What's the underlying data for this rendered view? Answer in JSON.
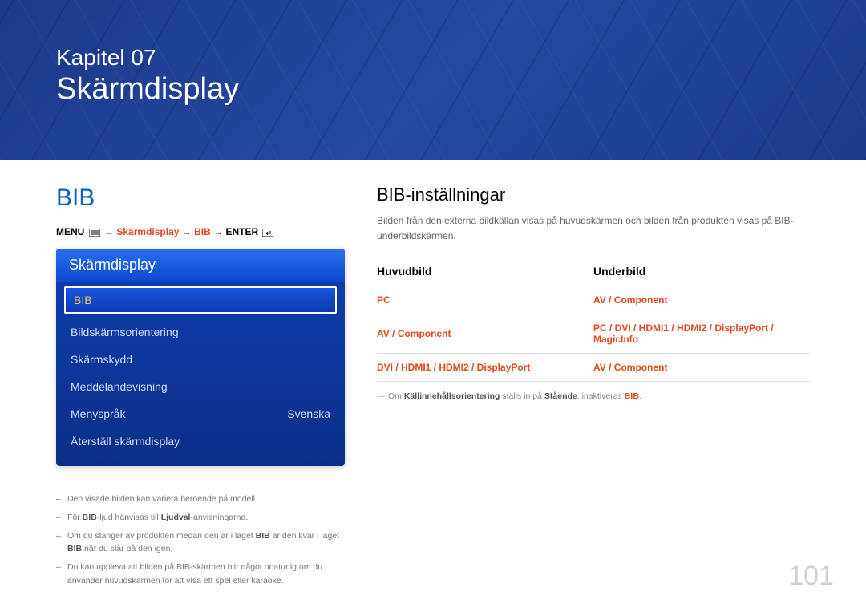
{
  "banner": {
    "kicker": "Kapitel 07",
    "title": "Skärmdisplay"
  },
  "left": {
    "section_title": "BIB",
    "breadcrumb": {
      "menu": "MENU",
      "arrow": "→",
      "p1": "Skärmdisplay",
      "p2": "BIB",
      "enter": "ENTER"
    },
    "menu": {
      "header": "Skärmdisplay",
      "items": [
        {
          "label": "BIB",
          "value": "",
          "selected": true
        },
        {
          "label": "Bildskärmsorientering",
          "value": ""
        },
        {
          "label": "Skärmskydd",
          "value": ""
        },
        {
          "label": "Meddelandevisning",
          "value": ""
        },
        {
          "label": "Menyspråk",
          "value": "Svenska"
        },
        {
          "label": "Återställ skärmdisplay",
          "value": ""
        }
      ]
    },
    "footnotes": {
      "f1": "Den visade bilden kan variera beroende på modell.",
      "f2a": "För ",
      "f2b": "BIB",
      "f2c": "-ljud hänvisas till ",
      "f2d": "Ljudval",
      "f2e": "-anvisningarna.",
      "f3a": "Om du stänger av produkten medan den är i läget ",
      "f3b": "BIB",
      "f3c": " är den kvar i läget ",
      "f3d": "BIB",
      "f3e": " när du slår på den igen.",
      "f4": "Du kan uppleva att bilden på BIB-skärmen blir något onaturlig om du använder huvudskärmen för att visa ett spel eller karaoke."
    }
  },
  "right": {
    "heading": "BIB-inställningar",
    "desc": "Bilden från den externa bildkällan visas på huvudskärmen och bilden från produkten visas på BIB-underbildskärmen.",
    "table": {
      "col1": "Huvudbild",
      "col2": "Underbild",
      "rows": [
        {
          "c1": "PC",
          "c2": "AV / Component"
        },
        {
          "c1": "AV / Component",
          "c2": "PC / DVI / HDMI1 / HDMI2 / DisplayPort / MagicInfo"
        },
        {
          "c1": "DVI / HDMI1 / HDMI2 / DisplayPort",
          "c2": "AV / Component"
        }
      ]
    },
    "note": {
      "a": "Om ",
      "b": "Källinnehållsorientering",
      "c": " ställs in på ",
      "d": "Stående",
      "e": ", inaktiveras ",
      "f": "BIB",
      "g": "."
    }
  },
  "page_number": "101"
}
